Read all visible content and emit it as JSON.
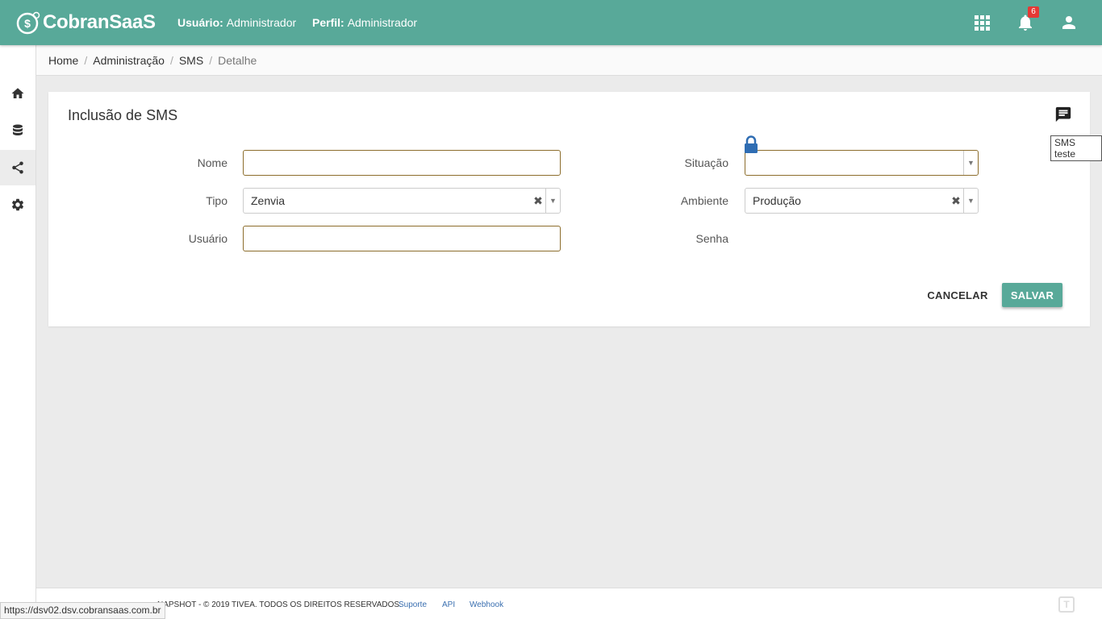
{
  "header": {
    "logo_text": "CobranSaaS",
    "user_label": "Usuário:",
    "user_value": "Administrador",
    "profile_label": "Perfil:",
    "profile_value": "Administrador",
    "notification_count": "6",
    "brand_color": "#58a999"
  },
  "sidebar": {
    "items": [
      {
        "icon": "home-icon"
      },
      {
        "icon": "database-icon"
      },
      {
        "icon": "share-icon",
        "active": true
      },
      {
        "icon": "gear-icon"
      }
    ]
  },
  "breadcrumb": {
    "items": [
      "Home",
      "Administração",
      "SMS"
    ],
    "current": "Detalhe"
  },
  "form": {
    "title": "Inclusão de SMS",
    "tooltip": "SMS teste",
    "nome_label": "Nome",
    "nome_value": "",
    "tipo_label": "Tipo",
    "tipo_value": "Zenvia",
    "usuario_label": "Usuário",
    "usuario_value": "",
    "situacao_label": "Situação",
    "situacao_value": "",
    "ambiente_label": "Ambiente",
    "ambiente_value": "Produção",
    "senha_label": "Senha",
    "cancel_label": "CANCELAR",
    "save_label": "SALVAR"
  },
  "footer": {
    "copyright": "NAPSHOT - © 2019 TIVEA. TODOS OS DIREITOS RESERVADOS.",
    "links": [
      "Suporte",
      "API",
      "Webhook"
    ]
  },
  "status_bar": {
    "url": "https://dsv02.dsv.cobransaas.com.br"
  }
}
